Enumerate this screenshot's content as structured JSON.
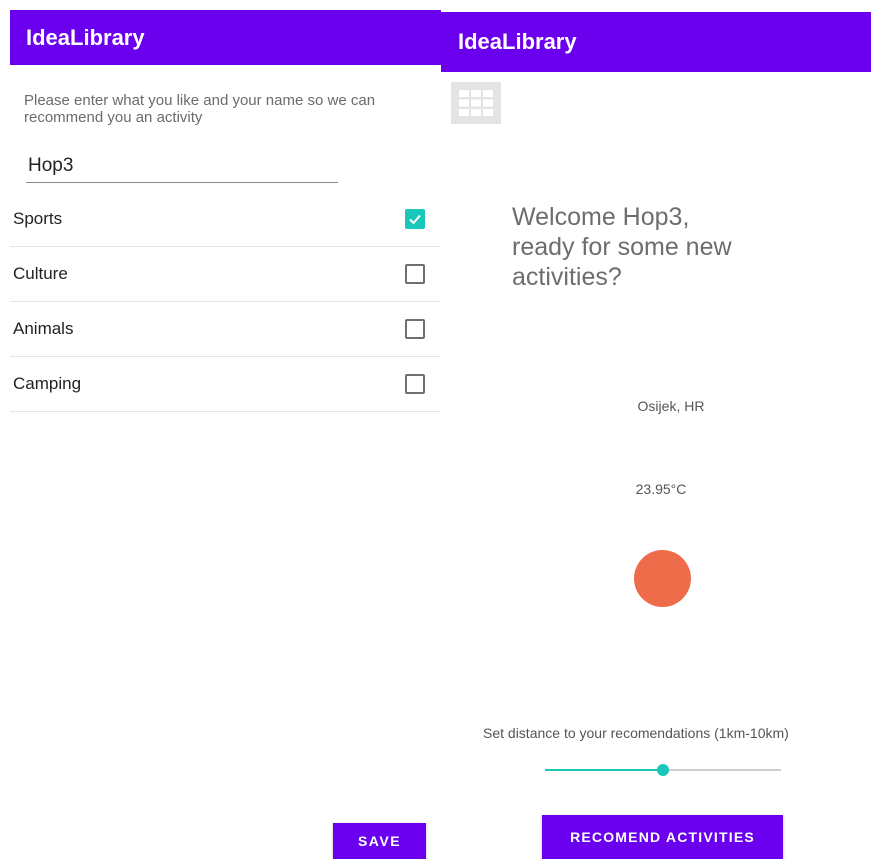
{
  "left_screen": {
    "app_title": "IdeaLibrary",
    "prompt": "Please enter what you like and your name so we can recommend you an activity",
    "name_value": "Hop3",
    "preferences": [
      {
        "label": "Sports",
        "checked": true
      },
      {
        "label": "Culture",
        "checked": false
      },
      {
        "label": "Animals",
        "checked": false
      },
      {
        "label": "Camping",
        "checked": false
      }
    ],
    "save_label": "SAVE"
  },
  "right_screen": {
    "app_title": "IdeaLibrary",
    "menu_icon": "grid-icon",
    "welcome_line1": "Welcome Hop3,",
    "welcome_line2": "ready for some new",
    "welcome_line3": "activities?",
    "location": "Osijek, HR",
    "temperature": "23.95°C",
    "weather_indicator_color": "#ee6c4a",
    "distance_label": "Set distance to your recomendations (1km-10km)",
    "distance_slider": {
      "min": 1,
      "max": 10,
      "value": 5.5
    },
    "recommend_label": "RECOMEND ACTIVITIES"
  },
  "colors": {
    "app_bar": "#6a00ee",
    "accent": "#19c8b8"
  }
}
